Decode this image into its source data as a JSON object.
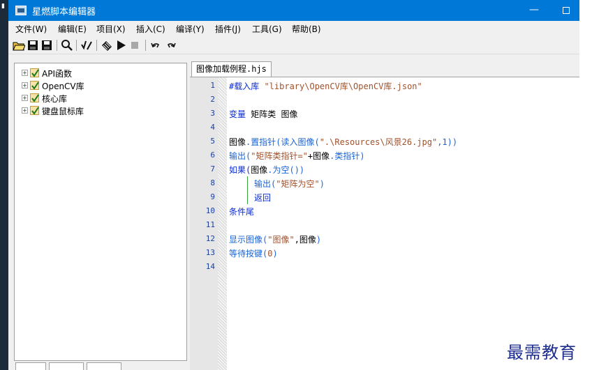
{
  "window": {
    "title": "星燃脚本编辑器",
    "minimize": "—"
  },
  "menu": [
    {
      "label": "文件(W)"
    },
    {
      "label": "编辑(E)"
    },
    {
      "label": "项目(X)"
    },
    {
      "label": "插入(C)"
    },
    {
      "label": "编译(Y)"
    },
    {
      "label": "插件(J)"
    },
    {
      "label": "工具(G)"
    },
    {
      "label": "帮助(B)"
    }
  ],
  "toolbar": [
    "open-icon",
    "save-icon",
    "save-all-icon",
    "find-icon",
    "check-icon",
    "build-icon",
    "run-icon",
    "stop-icon",
    "undo-icon",
    "redo-icon"
  ],
  "tree": [
    {
      "label": "API函数"
    },
    {
      "label": "OpenCV库"
    },
    {
      "label": "核心库"
    },
    {
      "label": "键盘鼠标库"
    }
  ],
  "editor": {
    "tab": "图像加载例程.hjs",
    "line_numbers": [
      "1",
      "2",
      "3",
      "4",
      "5",
      "6",
      "7",
      "8",
      "9",
      "10",
      "11",
      "12",
      "13",
      "14"
    ],
    "lines": {
      "l1": {
        "kw": "#载入库 ",
        "str": "\"library\\OpenCV库\\OpenCV库.json\""
      },
      "l3": {
        "kw": "变量 ",
        "text": "矩阵类 图像"
      },
      "l5": {
        "a": "图像",
        "b": ".置指针(读入图像(",
        "c": "\".\\Resources\\风景26.jpg\"",
        "d": ",1))"
      },
      "l6": {
        "a": "输出(",
        "b": "\"矩阵类指针=\"",
        "c": "+图像",
        "d": ".类指针)"
      },
      "l7": {
        "a": "如果(",
        "b": "图像",
        "c": ".为空())"
      },
      "l8": {
        "a": "输出(",
        "b": "\"矩阵为空\"",
        "c": ")"
      },
      "l9": {
        "a": "返回"
      },
      "l10": {
        "a": "条件尾"
      },
      "l12": {
        "a": "显示图像(",
        "b": "\"图像\"",
        "c": ",图像",
        "d": ")"
      },
      "l13": {
        "a": "等待按键(",
        "b": "0",
        "c": ")"
      }
    }
  },
  "watermark": "最需教育"
}
